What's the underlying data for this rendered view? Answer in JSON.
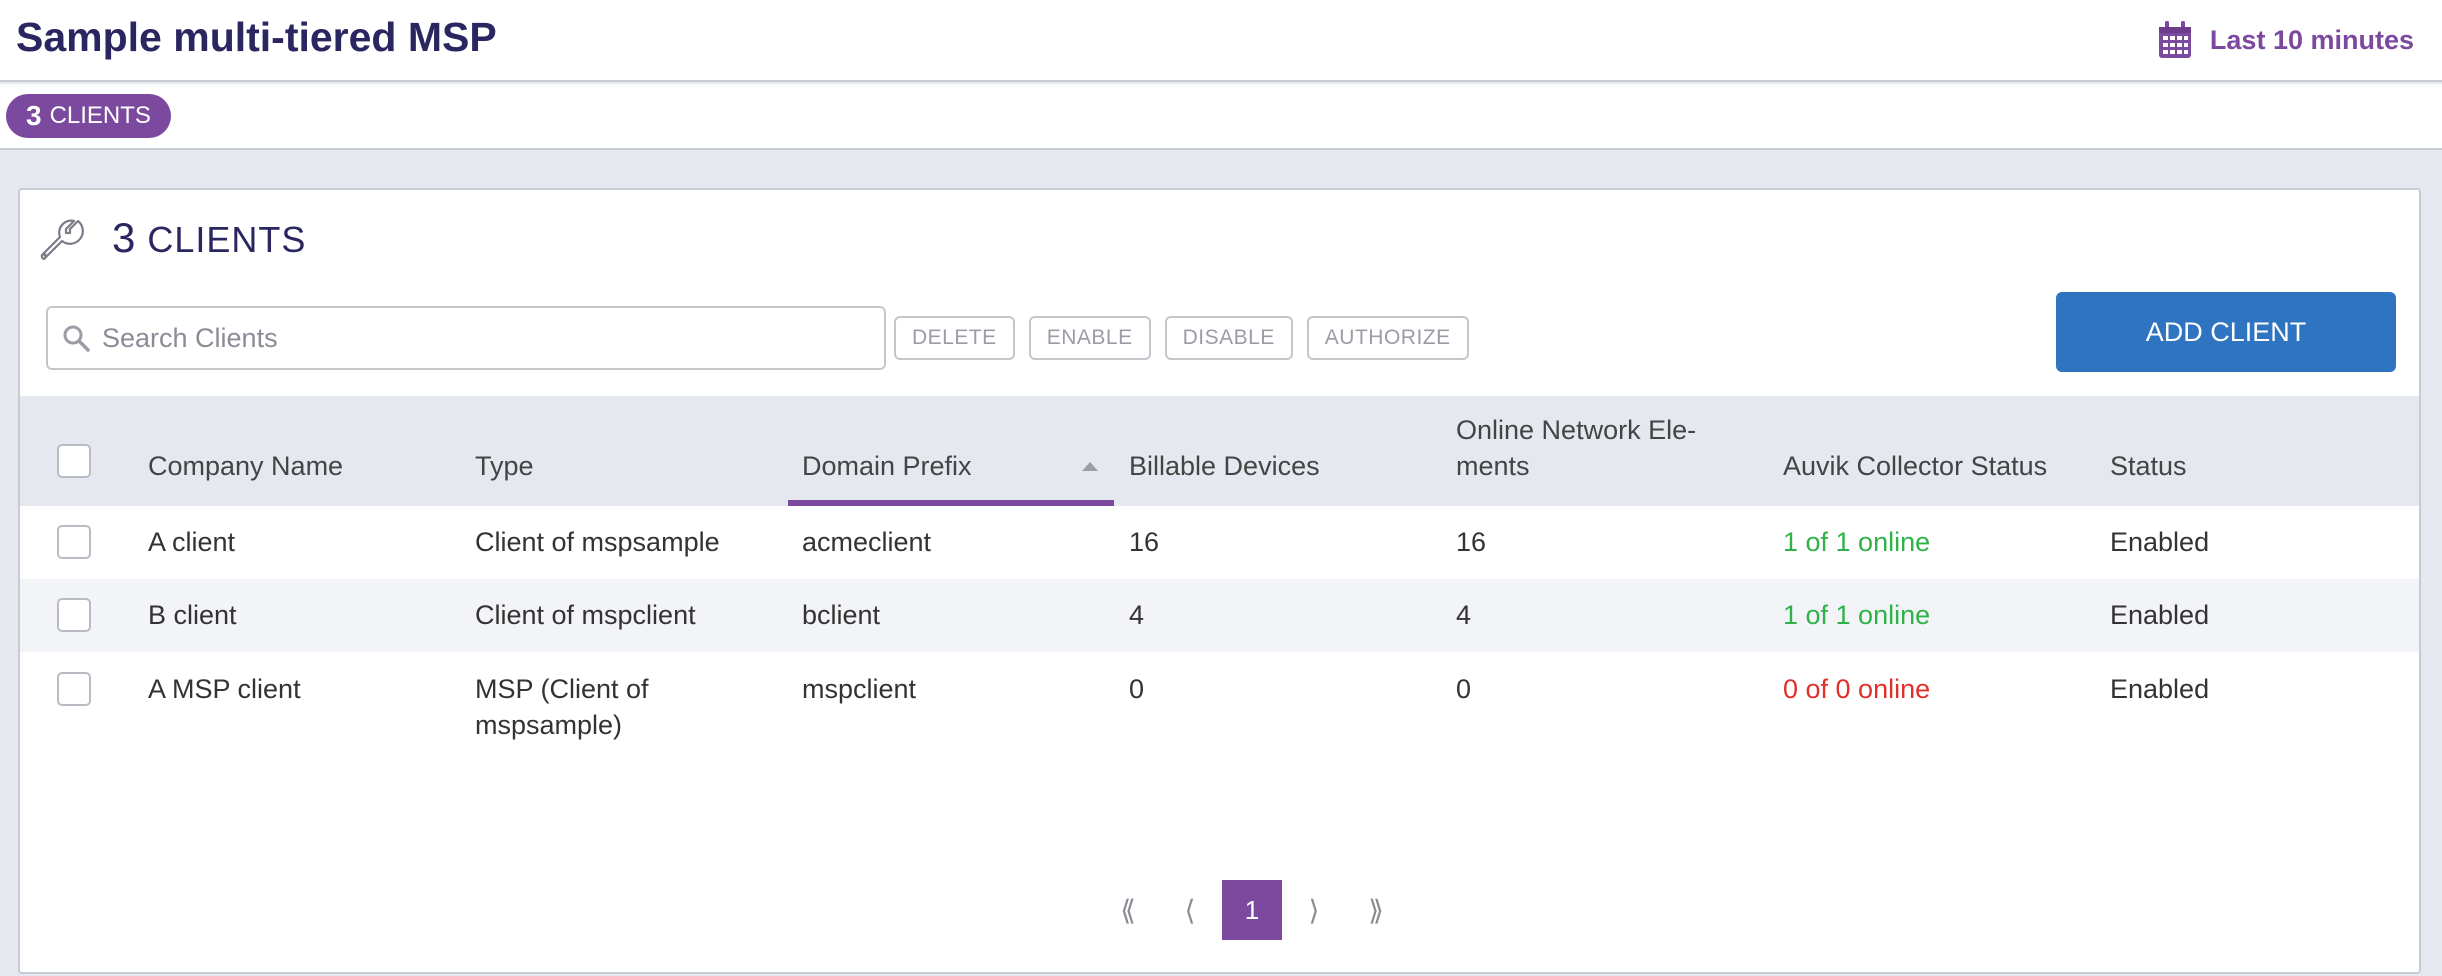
{
  "header": {
    "title": "Sample multi-tiered MSP",
    "time_range": "Last 10 minutes",
    "time_icon": "calendar-icon",
    "accent": "#7b4a9e"
  },
  "subbar": {
    "count": "3",
    "label": "CLIENTS"
  },
  "panel": {
    "icon": "wrench-icon",
    "count": "3",
    "label": "CLIENTS",
    "search_placeholder": "Search Clients",
    "search_value": "",
    "actions": [
      "DELETE",
      "ENABLE",
      "DISABLE",
      "AUTHORIZE"
    ],
    "add_label": "ADD CLIENT",
    "add_color": "#2f74c0"
  },
  "table": {
    "columns": {
      "company": "Company Name",
      "type": "Type",
      "domain": "Domain Prefix",
      "billable": "Billable Devices",
      "online_line1": "Online Network Ele-",
      "online_line2": "ments",
      "collector": "Auvik Collector Status",
      "status": "Status"
    },
    "sorted_by": "Domain Prefix",
    "sort_direction": "ascending",
    "rows": [
      {
        "company": "A client",
        "type": "Client of mspsample",
        "domain": "acmeclient",
        "billable": "16",
        "online": "16",
        "collector": "1 of 1 online",
        "collector_state": "ok",
        "status": "Enabled"
      },
      {
        "company": "B client",
        "type": "Client of mspclient",
        "domain": "bclient",
        "billable": "4",
        "online": "4",
        "collector": "1 of 1 online",
        "collector_state": "ok",
        "status": "Enabled"
      },
      {
        "company": "A MSP client",
        "type_line1": "MSP (Client of",
        "type_line2": "mspsample)",
        "domain": "mspclient",
        "billable": "0",
        "online": "0",
        "collector": "0 of 0 online",
        "collector_state": "down",
        "status": "Enabled"
      }
    ],
    "status_colors": {
      "ok": "#2db34a",
      "down": "#e0302c"
    }
  },
  "pagination": {
    "first": "⟪",
    "prev": "⟨",
    "current": "1",
    "next": "⟩",
    "last": "⟫"
  }
}
